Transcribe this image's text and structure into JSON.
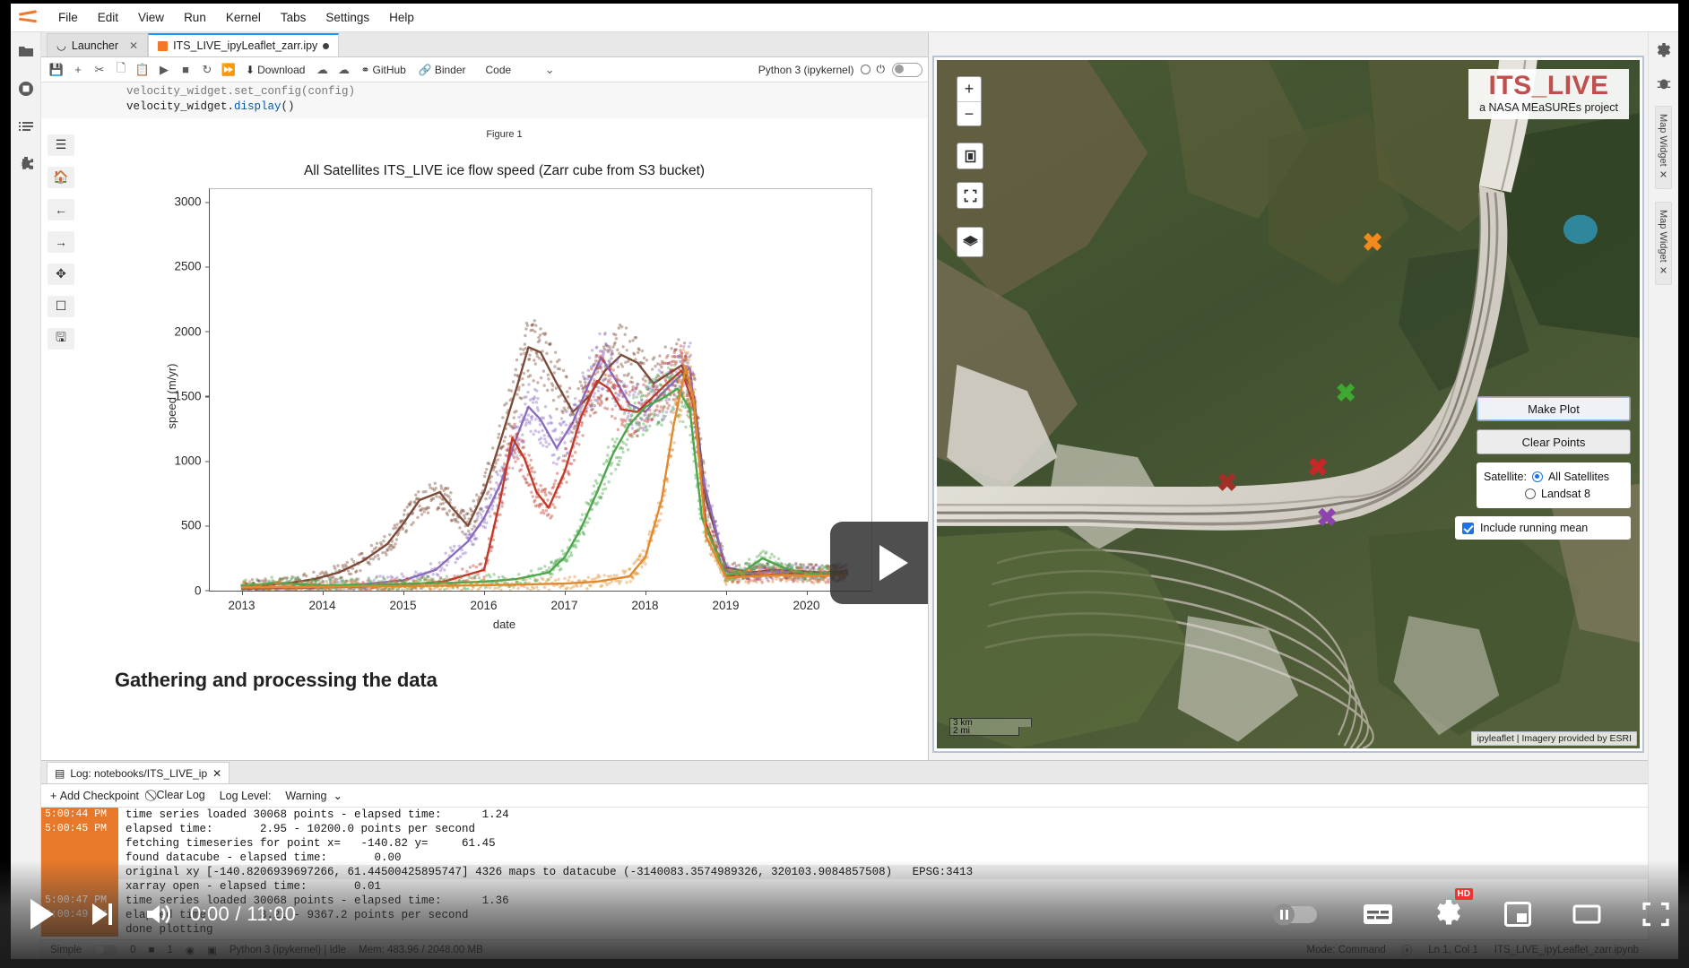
{
  "menubar": {
    "logo_name": "jupyter-logo",
    "items": [
      "File",
      "Edit",
      "View",
      "Run",
      "Kernel",
      "Tabs",
      "Settings",
      "Help"
    ]
  },
  "left_rail": [
    {
      "name": "file-browser-icon",
      "glyph": "folder"
    },
    {
      "name": "running-sessions-icon",
      "glyph": "stop"
    },
    {
      "name": "table-of-contents-icon",
      "glyph": "list"
    },
    {
      "name": "extension-manager-icon",
      "glyph": "puzzle"
    }
  ],
  "right_rail": [
    {
      "name": "property-inspector-icon",
      "glyph": "gear"
    },
    {
      "name": "debugger-icon",
      "glyph": "bug"
    },
    {
      "name": "map-widget-tab-1",
      "label": "Map Widget ✕"
    },
    {
      "name": "map-widget-tab-2",
      "label": "Map Widget ✕"
    }
  ],
  "tabs": [
    {
      "label": "Launcher",
      "active": false,
      "dirty": false
    },
    {
      "label": "ITS_LIVE_ipyLeaflet_zarr.ipy",
      "active": true,
      "dirty": true
    }
  ],
  "notebook_toolbar": {
    "icons": [
      "save",
      "add",
      "cut",
      "copy",
      "paste",
      "run",
      "stop",
      "restart",
      "restart-run-all"
    ],
    "download_label": "Download",
    "github_label": "GitHub",
    "binder_label": "Binder",
    "celltype_value": "Code",
    "kernel_label": "Python 3 (ipykernel)"
  },
  "code_cell": {
    "line1": "velocity_widget.set_config(config)",
    "line2_obj": "velocity_widget.",
    "line2_fn": "display",
    "line2_tail": "()"
  },
  "figure": {
    "caption": "Figure 1",
    "mpl_tools": [
      "menu",
      "home",
      "back",
      "forward",
      "pan",
      "zoom-rect",
      "save"
    ]
  },
  "markdown_heading": "Gathering and processing the data",
  "chart_data": {
    "type": "scatter",
    "title": "All Satellites ITS_LIVE ice flow speed (Zarr cube from S3 bucket)",
    "xlabel": "date",
    "ylabel": "speed (m/yr)",
    "xlim": [
      2012.6,
      2020.8
    ],
    "ylim": [
      0,
      3100
    ],
    "xticks": [
      2013,
      2014,
      2015,
      2016,
      2017,
      2018,
      2019,
      2020
    ],
    "yticks": [
      0,
      500,
      1000,
      1500,
      2000,
      2500,
      3000
    ],
    "grid": false,
    "legend": "none",
    "series": [
      {
        "name": "point-brown",
        "color": "#7B4A38",
        "x": [
          2013.0,
          2013.3,
          2013.6,
          2013.9,
          2014.2,
          2014.5,
          2014.8,
          2015.0,
          2015.2,
          2015.45,
          2015.6,
          2015.8,
          2016.0,
          2016.2,
          2016.4,
          2016.55,
          2016.7,
          2016.9,
          2017.1,
          2017.3,
          2017.5,
          2017.7,
          2017.9,
          2018.1,
          2018.3,
          2018.45,
          2018.6,
          2018.75,
          2019.0,
          2019.3,
          2019.6,
          2019.9,
          2020.2,
          2020.5
        ],
        "values": [
          30,
          45,
          60,
          90,
          140,
          230,
          360,
          520,
          700,
          760,
          640,
          500,
          760,
          1150,
          1560,
          1880,
          1840,
          1600,
          1380,
          1500,
          1700,
          1820,
          1760,
          1600,
          1680,
          1740,
          1500,
          700,
          180,
          140,
          160,
          150,
          140,
          150
        ]
      },
      {
        "name": "point-purple",
        "color": "#8A6BBE",
        "x": [
          2013.0,
          2013.5,
          2014.0,
          2014.5,
          2015.0,
          2015.4,
          2015.8,
          2016.0,
          2016.2,
          2016.4,
          2016.55,
          2016.7,
          2016.9,
          2017.1,
          2017.3,
          2017.45,
          2017.6,
          2017.8,
          2018.0,
          2018.2,
          2018.4,
          2018.55,
          2018.7,
          2019.0,
          2019.3,
          2019.6,
          2019.9,
          2020.2,
          2020.5
        ],
        "values": [
          20,
          25,
          35,
          50,
          80,
          160,
          380,
          560,
          820,
          1180,
          1420,
          1320,
          1100,
          1300,
          1600,
          1800,
          1660,
          1440,
          1380,
          1520,
          1640,
          1720,
          900,
          150,
          130,
          150,
          140,
          130,
          140
        ]
      },
      {
        "name": "point-red",
        "color": "#C0392B",
        "x": [
          2013.0,
          2013.5,
          2014.0,
          2014.5,
          2015.0,
          2015.5,
          2016.0,
          2016.2,
          2016.35,
          2016.5,
          2016.65,
          2016.8,
          2017.0,
          2017.2,
          2017.4,
          2017.55,
          2017.7,
          2017.9,
          2018.1,
          2018.3,
          2018.45,
          2018.6,
          2018.75,
          2019.0,
          2019.4,
          2019.8,
          2020.2,
          2020.5
        ],
        "values": [
          15,
          20,
          25,
          30,
          45,
          70,
          160,
          700,
          1180,
          1020,
          760,
          640,
          920,
          1340,
          1620,
          1560,
          1400,
          1380,
          1500,
          1620,
          1700,
          1420,
          520,
          110,
          120,
          130,
          120,
          130
        ]
      },
      {
        "name": "point-green",
        "color": "#4CA64C",
        "x": [
          2013.0,
          2013.4,
          2013.7,
          2014.0,
          2014.4,
          2014.8,
          2015.2,
          2015.6,
          2016.0,
          2016.4,
          2016.8,
          2017.0,
          2017.2,
          2017.4,
          2017.6,
          2017.8,
          2018.0,
          2018.2,
          2018.4,
          2018.55,
          2018.7,
          2019.0,
          2019.2,
          2019.45,
          2019.7,
          2020.0,
          2020.4
        ],
        "values": [
          35,
          60,
          50,
          40,
          45,
          50,
          55,
          60,
          70,
          90,
          140,
          260,
          480,
          760,
          1060,
          1280,
          1420,
          1480,
          1560,
          1400,
          560,
          120,
          140,
          250,
          180,
          130,
          140
        ]
      },
      {
        "name": "point-orange",
        "color": "#E08A2E",
        "x": [
          2013.0,
          2013.5,
          2014.0,
          2014.5,
          2015.0,
          2015.5,
          2016.0,
          2016.5,
          2017.0,
          2017.4,
          2017.8,
          2018.0,
          2018.2,
          2018.35,
          2018.5,
          2018.6,
          2018.75,
          2019.0,
          2019.3,
          2019.7,
          2020.1,
          2020.5
        ],
        "values": [
          25,
          28,
          30,
          32,
          35,
          38,
          42,
          48,
          55,
          70,
          110,
          260,
          700,
          1280,
          1720,
          1460,
          420,
          100,
          110,
          120,
          115,
          120
        ]
      }
    ],
    "note": "scatter cloud of per-scene speeds with overlaid running-mean curves, one color per map point"
  },
  "play_overlay": {
    "name": "figure-play-button"
  },
  "map": {
    "logo_title": "ITS_LIVE",
    "logo_subtitle": "a NASA MEaSUREs project",
    "zoom_in": "+",
    "zoom_out": "−",
    "buttons": [
      {
        "name": "make-plot-button",
        "label": "Make Plot"
      },
      {
        "name": "clear-points-button",
        "label": "Clear Points"
      }
    ],
    "satellite_label": "Satellite:",
    "satellite_options": [
      {
        "label": "All Satellites",
        "selected": true
      },
      {
        "label": "Landsat 8",
        "selected": false
      }
    ],
    "running_mean_label": "Include running mean",
    "running_mean_checked": true,
    "scale_km": "3 km",
    "scale_mi": "2 mi",
    "attribution": "ipyleaflet | Imagery provided by ESRI",
    "markers": [
      {
        "name": "map-marker-orange",
        "color": "#F08A1E",
        "x": 62.0,
        "y": 26.5
      },
      {
        "name": "map-marker-green",
        "color": "#3EA832",
        "x": 58.2,
        "y": 48.5
      },
      {
        "name": "map-marker-red",
        "color": "#C62828",
        "x": 54.2,
        "y": 59.5
      },
      {
        "name": "map-marker-darkred",
        "color": "#A03028",
        "x": 41.3,
        "y": 61.5
      },
      {
        "name": "map-marker-purple",
        "color": "#8E44AD",
        "x": 55.5,
        "y": 0.0
      }
    ]
  },
  "log_panel": {
    "tab_label": "Log: notebooks/ITS_LIVE_ip",
    "add_checkpoint": "Add Checkpoint",
    "clear_log": "Clear Log",
    "log_level_label": "Log Level:",
    "log_level_value": "Warning",
    "entries": [
      {
        "time": "5:00:44 PM",
        "lines": [
          "time series loaded 30068 points - elapsed time:      1.24"
        ]
      },
      {
        "time": "5:00:45 PM",
        "lines": [
          "elapsed time:       2.95 - 10200.0 points per second",
          "fetching timeseries for point x=   -140.82 y=     61.45",
          "found datacube - elapsed time:       0.00",
          "original xy [-140.8206939697266, 61.44500425895747] 4326 maps to datacube (-3140083.3574989326, 320103.9084857508)   EPSG:3413",
          "xarray open - elapsed time:       0.01"
        ]
      },
      {
        "time": "5:00:47 PM",
        "lines": [
          "time series loaded 30068 points - elapsed time:      1.36"
        ]
      },
      {
        "time": "5:00:49 PM",
        "lines": [
          "elapsed time:       3.21 - 9367.2 points per second",
          "done plotting"
        ]
      }
    ]
  },
  "statusbar": {
    "simple_label": "Simple",
    "terminals_count": "0",
    "kernels_count": "1",
    "kernel_status": "Python 3 (ipykernel) | Idle",
    "memory": "Mem: 483.96 / 2048.00 MB",
    "mode": "Mode: Command",
    "cursor": "Ln 1, Col 1",
    "filename": "ITS_LIVE_ipyLeaflet_zarr.ipynb"
  },
  "video_player": {
    "play_name": "play-button",
    "next_name": "next-video-button",
    "volume_name": "volume-button",
    "time_display": "0:00 / 11:00",
    "autoplay_name": "autoplay-toggle",
    "subtitles_name": "subtitles-button",
    "settings_name": "settings-gear-icon",
    "quality_badge": "HD",
    "miniplayer_name": "miniplayer-button",
    "theater_name": "theater-mode-button",
    "fullscreen_name": "fullscreen-button"
  }
}
